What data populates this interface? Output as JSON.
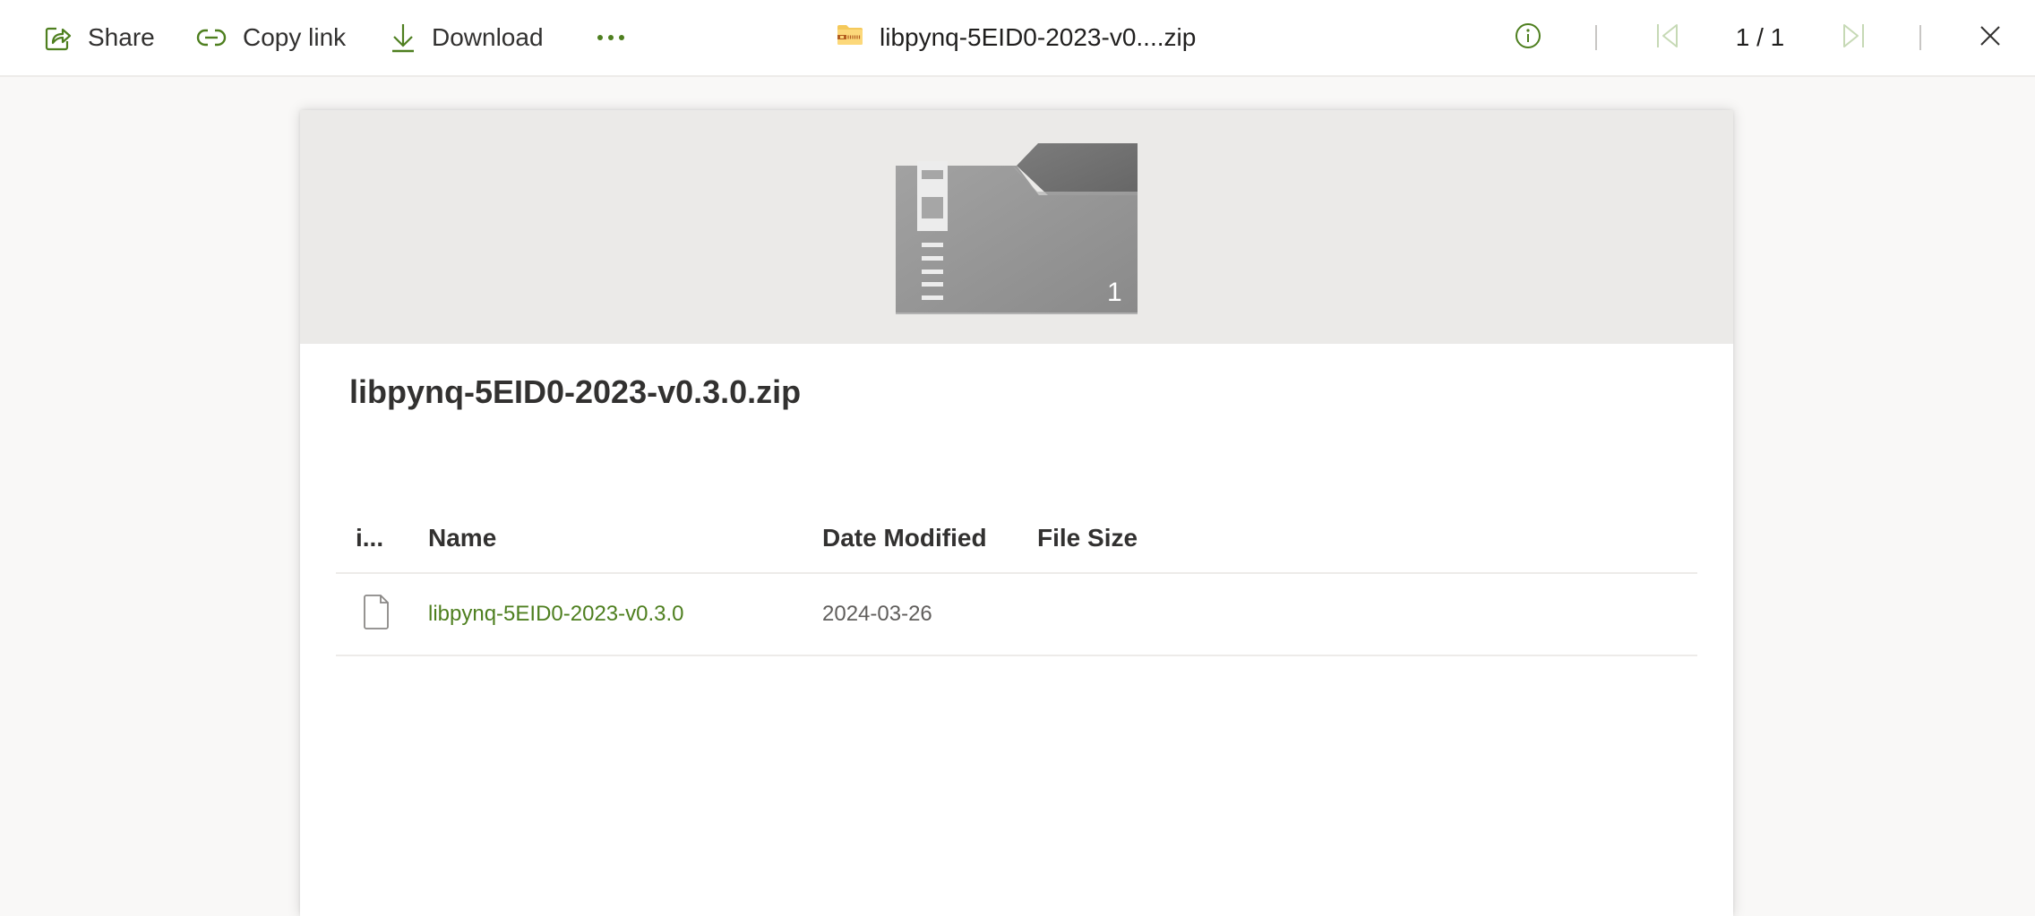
{
  "toolbar": {
    "share_label": "Share",
    "copy_link_label": "Copy link",
    "download_label": "Download",
    "more_label": "More options",
    "file_title": "libpynq-5EID0-2023-v0....zip",
    "pager": "1 / 1",
    "icons": {
      "share": "share-icon",
      "copy_link": "link-icon",
      "download": "download-arrow-icon",
      "more": "ellipsis-icon",
      "file_type": "zip-folder-icon",
      "info": "info-icon",
      "first": "first-page-icon",
      "last": "last-page-icon",
      "close": "close-icon"
    }
  },
  "colors": {
    "accent": "#4e7f1f",
    "accent_disabled": "#c6d9b5",
    "hero_background": "#ebeae8",
    "page_background": "#f9f8f7"
  },
  "preview": {
    "archive_item_count": "1",
    "title": "libpynq-5EID0-2023-v0.3.0.zip",
    "table": {
      "columns": [
        "i...",
        "Name",
        "Date Modified",
        "File Size"
      ],
      "rows": [
        {
          "icon": "file-icon",
          "name": "libpynq-5EID0-2023-v0.3.0",
          "date_modified": "2024-03-26",
          "file_size": ""
        }
      ]
    }
  }
}
